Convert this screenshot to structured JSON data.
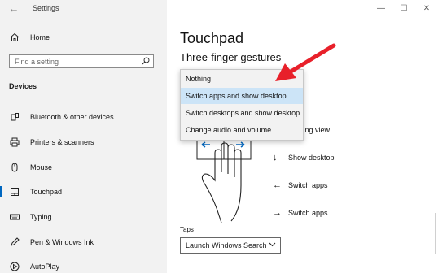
{
  "window": {
    "title": "Settings",
    "minimize": "—",
    "maximize": "☐",
    "close": "✕",
    "back": "←"
  },
  "sidebar": {
    "home": "Home",
    "search_placeholder": "Find a setting",
    "section_title": "Devices",
    "items": [
      {
        "label": "Bluetooth & other devices",
        "icon": "bluetooth-icon"
      },
      {
        "label": "Printers & scanners",
        "icon": "printer-icon"
      },
      {
        "label": "Mouse",
        "icon": "mouse-icon"
      },
      {
        "label": "Touchpad",
        "icon": "touchpad-icon",
        "active": true
      },
      {
        "label": "Typing",
        "icon": "keyboard-icon"
      },
      {
        "label": "Pen & Windows Ink",
        "icon": "pen-icon"
      },
      {
        "label": "AutoPlay",
        "icon": "autoplay-icon"
      }
    ]
  },
  "main": {
    "title": "Touchpad",
    "section": "Three-finger gestures",
    "dropdown_options": [
      "Nothing",
      "Switch apps and show desktop",
      "Switch desktops and show desktop",
      "Change audio and volume"
    ],
    "selected_index": 1,
    "gesture_list": [
      {
        "arrow": "↑",
        "label": "itasking view"
      },
      {
        "arrow": "↓",
        "label": "Show desktop"
      },
      {
        "arrow": "←",
        "label": "Switch apps"
      },
      {
        "arrow": "→",
        "label": "Switch apps"
      }
    ],
    "taps_label": "Taps",
    "taps_value": "Launch Windows Search"
  },
  "colors": {
    "accent": "#0067c0",
    "annotation_arrow": "#e8202a",
    "selected_option": "#cce4f7"
  }
}
